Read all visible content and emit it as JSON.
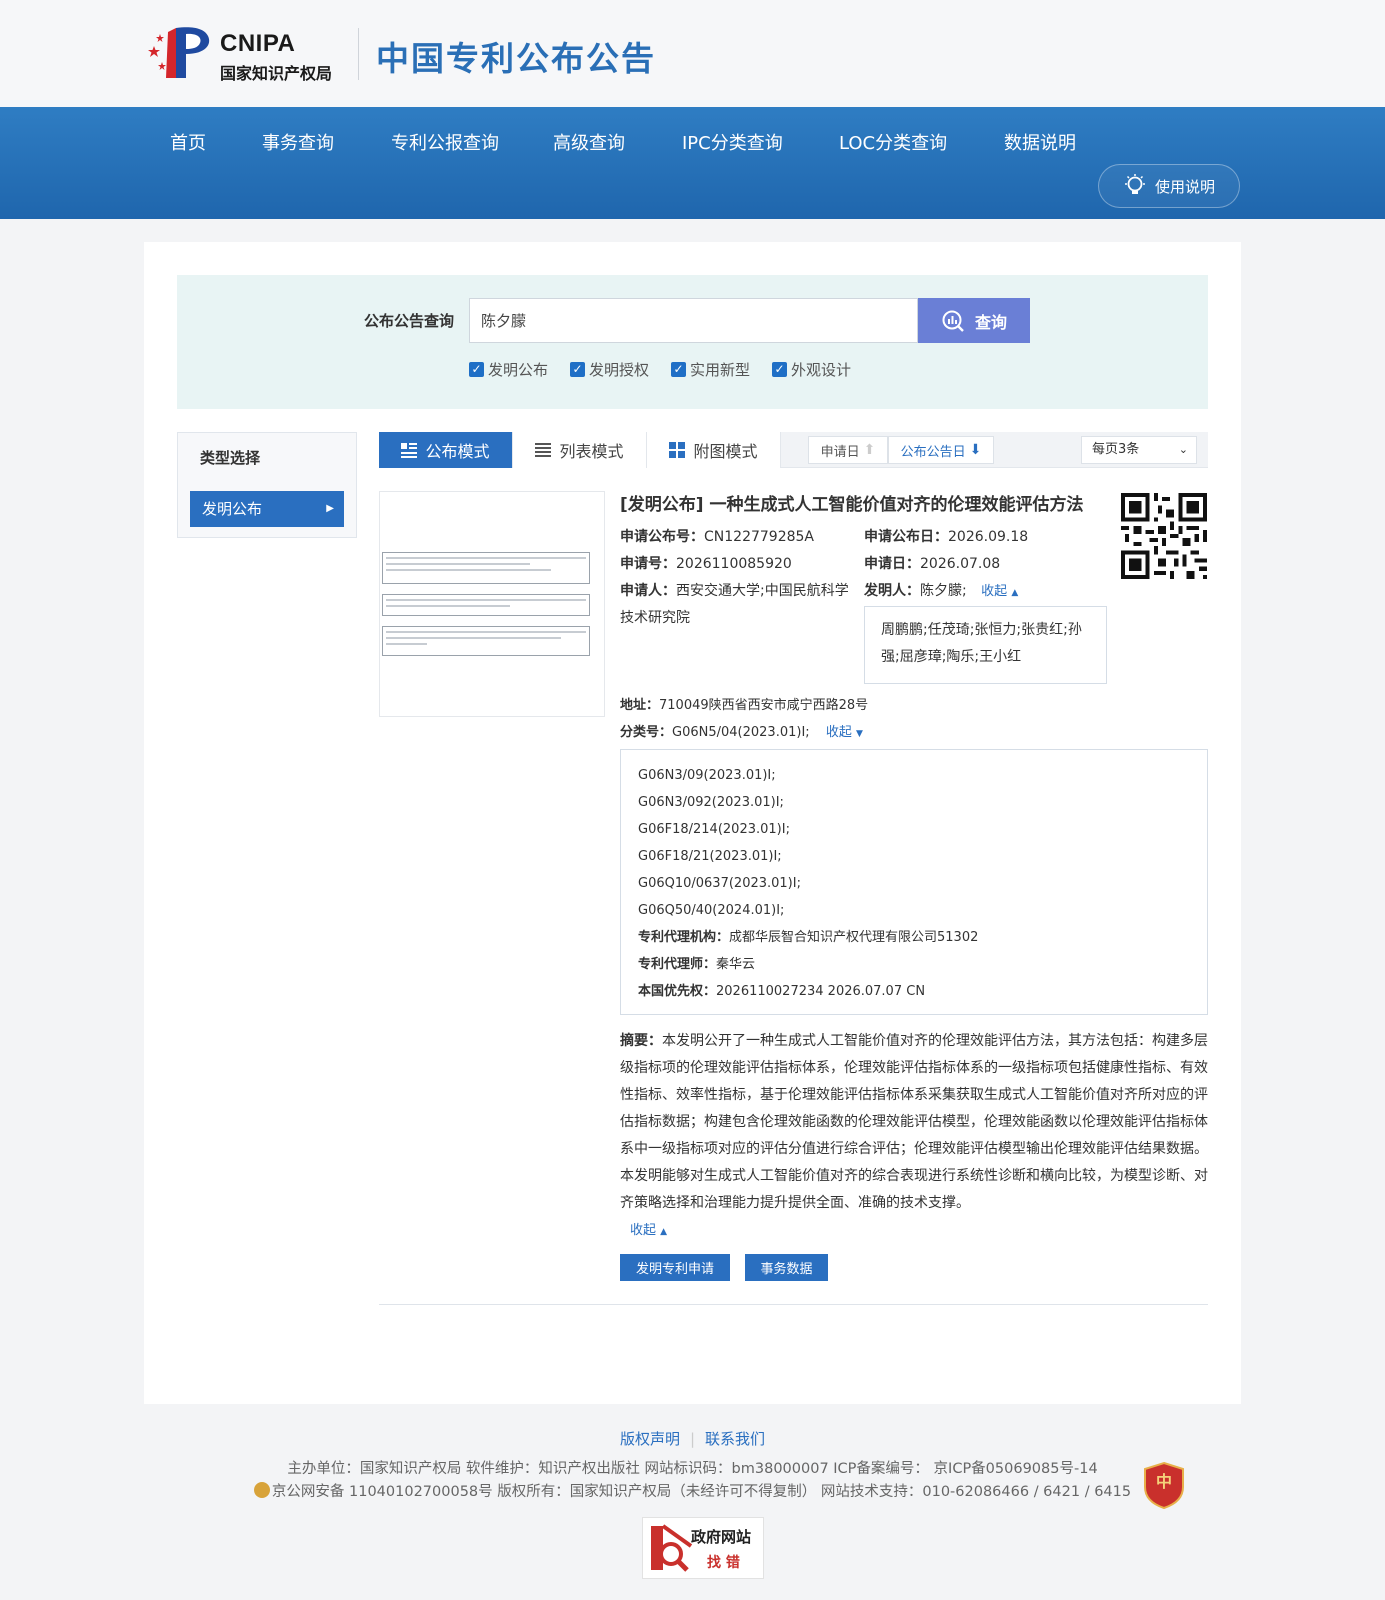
{
  "header": {
    "logo_en": "CNIPA",
    "logo_zh": "国家知识产权局",
    "site_title": "中国专利公布公告",
    "nav": [
      "首页",
      "事务查询",
      "专利公报查询",
      "高级查询",
      "IPC分类查询",
      "LOC分类查询",
      "数据说明"
    ],
    "help_label": "使用说明"
  },
  "search": {
    "label": "公布公告查询",
    "value": "陈夕朦",
    "button": "查询",
    "types": [
      "发明公布",
      "发明授权",
      "实用新型",
      "外观设计"
    ]
  },
  "sidebar": {
    "title": "类型选择",
    "items": [
      {
        "label": "发明公布"
      }
    ]
  },
  "toolbar": {
    "modes": [
      "公布模式",
      "列表模式",
      "附图模式"
    ],
    "sort_apply": "申请日",
    "sort_pub": "公布公告日",
    "per_page": "每页3条"
  },
  "result": {
    "title": "[发明公布] 一种生成式人工智能价值对齐的伦理效能评估方法",
    "pub_no_label": "申请公布号：",
    "pub_no": "CN122779285A",
    "pub_date_label": "申请公布日：",
    "pub_date": "2026.09.18",
    "app_no_label": "申请号：",
    "app_no": "2026110085920",
    "app_date_label": "申请日：",
    "app_date": "2026.07.08",
    "applicant_label": "申请人：",
    "applicant_line1": "西安交通大学;中国民航科学",
    "applicant_line2": "技术研究院",
    "inventor_label": "发明人：",
    "inventor_first": "陈夕朦;",
    "collapse": "收起",
    "inventors_more_line1": "周鹏鹏;任茂琦;张恒力;张贵红;孙",
    "inventors_more_line2": "强;屈彦璋;陶乐;王小红",
    "address_label": "地址：",
    "address": "710049陕西省西安市咸宁西路28号",
    "class_label": "分类号：",
    "class_first": "G06N5/04(2023.01)I;",
    "classes": [
      "G06N3/09(2023.01)I;",
      "G06N3/092(2023.01)I;",
      "G06F18/214(2023.01)I;",
      "G06F18/21(2023.01)I;",
      "G06Q10/0637(2023.01)I;",
      "G06Q50/40(2024.01)I;"
    ],
    "agency_label": "专利代理机构：",
    "agency": "成都华辰智合知识产权代理有限公司51302",
    "agent_label": "专利代理师：",
    "agent": "秦华云",
    "priority_label": "本国优先权：",
    "priority": "2026110027234 2026.07.07 CN",
    "abstract_label": "摘要：",
    "abstract": "本发明公开了一种生成式人工智能价值对齐的伦理效能评估方法，其方法包括：构建多层级指标项的伦理效能评估指标体系，伦理效能评估指标体系的一级指标项包括健康性指标、有效性指标、效率性指标，基于伦理效能评估指标体系采集获取生成式人工智能价值对齐所对应的评估指标数据；构建包含伦理效能函数的伦理效能评估模型，伦理效能函数以伦理效能评估指标体系中一级指标项对应的评估分值进行综合评估；伦理效能评估模型输出伦理效能评估结果数据。本发明能够对生成式人工智能价值对齐的综合表现进行系统性诊断和横向比较，为模型诊断、对齐策略选择和治理能力提升提供全面、准确的技术支撑。",
    "btn_application": "发明专利申请",
    "btn_affairs": "事务数据"
  },
  "footer": {
    "link_copyright": "版权声明",
    "link_contact": "联系我们",
    "line1": "主办单位：国家知识产权局    软件维护：知识产权出版社    网站标识码：bm38000007    ICP备案编号：  京ICP备05069085号-14",
    "line2": "京公网安备 11040102700058号  版权所有：国家知识产权局（未经许可不得复制）    网站技术支持：010-62086466 / 6421 / 6415",
    "gov_badge_line1": "政府网站",
    "gov_badge_line2": "找 错"
  }
}
